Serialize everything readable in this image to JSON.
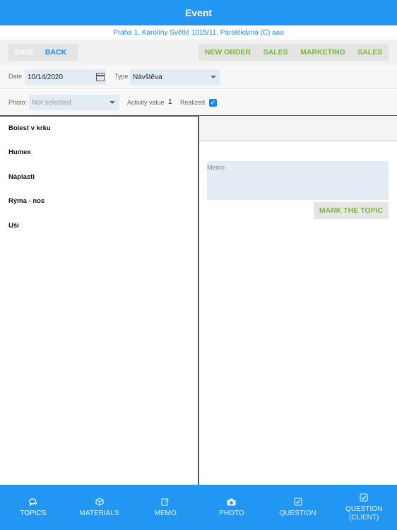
{
  "header": {
    "title": "Event"
  },
  "address": "Praha 1, Karolíny Světlé 1015/11, Paralékárna (C) aaa",
  "toolbar": {
    "save_label": "SAVE",
    "back_label": "BACK",
    "new_order_label": "NEW ORDER",
    "sales_label": "SALES",
    "marketing_label": "MARKETING",
    "sales2_label": "SALES"
  },
  "form": {
    "date_label": "Date",
    "date_value": "10/14/2020",
    "type_label": "Type",
    "type_value": "Návštěva",
    "photo_label": "Photo:",
    "photo_value": "Not selected",
    "activity_label": "Activity value",
    "activity_value": "1",
    "realized_label": "Realized",
    "realized_checked": true
  },
  "topics": [
    {
      "label": "Bolest v krku"
    },
    {
      "label": "Humex"
    },
    {
      "label": "Náplasti"
    },
    {
      "label": "Rýma - nos"
    },
    {
      "label": "Uši"
    }
  ],
  "detail": {
    "memo_placeholder": "Memo",
    "mark_label": "MARK THE TOPIC"
  },
  "bottom_nav": [
    {
      "label": "TOPICS",
      "icon": "chat-icon",
      "active": true
    },
    {
      "label": "MATERIALS",
      "icon": "cube-icon",
      "active": false
    },
    {
      "label": "MEMO",
      "icon": "edit-icon",
      "active": false
    },
    {
      "label": "PHOTO",
      "icon": "camera-icon",
      "active": false
    },
    {
      "label": "QUESTION",
      "icon": "check-square-icon",
      "active": false
    },
    {
      "label": "QUESTION (CLIENT)",
      "icon": "check-square-icon",
      "active": false
    }
  ],
  "colors": {
    "primary": "#2196f3",
    "accent_green": "#7cb342",
    "field_bg": "#e3ecf5"
  }
}
